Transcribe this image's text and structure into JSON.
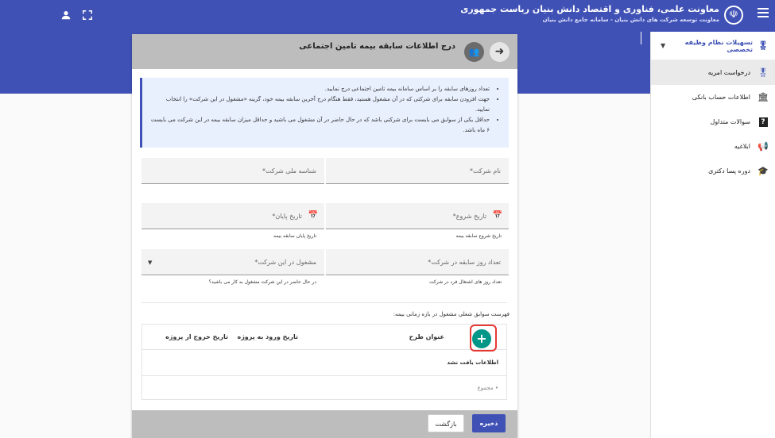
{
  "header": {
    "title": "معاونت علمی، فناوری و اقتصاد دانش بنیان ریاست جمهوری",
    "subtitle": "معاونت توسعه شرکت های دانش بنیان - سامانه جامع دانش بنیان",
    "menu_icon": "hamburger-icon",
    "user_icon": "person-icon",
    "fullscreen_icon": "fullscreen-icon"
  },
  "sidebar": {
    "group": {
      "label": "تسهیلات نظام وظیفه تخصصی",
      "icon": "medal-icon"
    },
    "items": [
      {
        "label": "درخواست امریه",
        "icon": "medal-icon",
        "active": true
      },
      {
        "label": "اطلاعات حساب بانکی",
        "icon": "bank-icon"
      },
      {
        "label": "سوالات متداول",
        "icon": "question-book-icon"
      },
      {
        "label": "ابلاغیه",
        "icon": "megaphone-icon"
      },
      {
        "label": "دوره پسا دکتری",
        "icon": "graduation-cap-icon"
      }
    ]
  },
  "page": {
    "title": "درج اطلاعات سابقه بیمه تامین اجتماعی"
  },
  "info": {
    "items": [
      "تعداد روزهای سابقه را بر اساس سامانه بیمه تامین اجتماعی درج نمایید.",
      "جهت افزودن سابقه برای شرکتی که در آن مشغول هستید، فقط هنگام درج آخرین سابقه بیمه خود، گزینه «مشغول در این شرکت» را انتخاب نمایید.",
      "حداقل یکی از سوابق می بایست برای شرکتی باشد که در حال حاضر در آن مشغول می باشید و حداقل میزان سابقه بیمه در این شرکت می بایست ۶ ماه باشد."
    ]
  },
  "form": {
    "company_name": {
      "placeholder": "نام شرکت*"
    },
    "national_id": {
      "placeholder": "شناسه ملی شرکت*"
    },
    "start_date": {
      "placeholder": "تاریخ شروع*",
      "hint": "تاریخ شروع سابقه بیمه"
    },
    "end_date": {
      "placeholder": "تاریخ پایان*",
      "hint": "تاریخ پایان سابقه بیمه"
    },
    "days": {
      "placeholder": "تعداد روز سابقه در شرکت*",
      "hint": "تعداد روز های اشتغال فرد در شرکت"
    },
    "employed": {
      "placeholder": "مشغول در این شرکت*",
      "hint": "در حال حاضر در این شرکت مشغول به کار می باشید؟"
    }
  },
  "list": {
    "title": "فهرست سوابق شغلی مشغول در بازه زمانی بیمه:",
    "columns": [
      "عنوان طرح",
      "تاریخ ورود به پروژه",
      "تاریخ خروج از پروژه"
    ],
    "empty_text": "اطلاعات یافت نشد",
    "sum_text": "• مجموع",
    "add_label": "+"
  },
  "actions": {
    "save": "ذخیره",
    "back": "بازگشت"
  },
  "colors": {
    "primary": "#3f51b5",
    "add_button": "#009688",
    "highlight": "#e53935"
  }
}
